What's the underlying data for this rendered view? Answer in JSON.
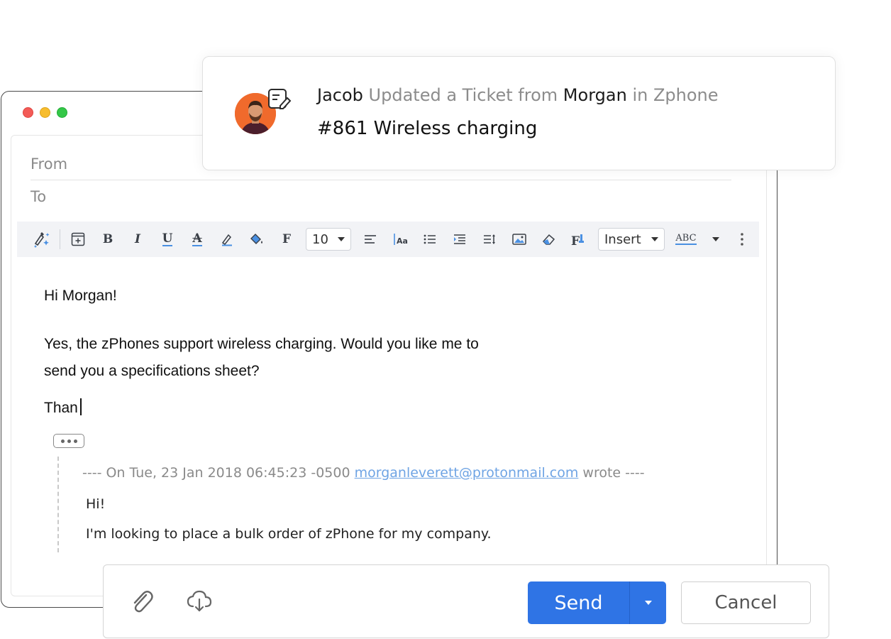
{
  "notification": {
    "actor": "Jacob",
    "action": "Updated a Ticket from",
    "customer": "Morgan",
    "in_label": "in Zphone",
    "ticket_title": "#861 Wireless charging"
  },
  "compose": {
    "from_label": "From",
    "to_label": "To",
    "toolbar": {
      "font_size": "10",
      "insert_label": "Insert",
      "spell_label": "ABC"
    },
    "body": {
      "greeting": "Hi Morgan!",
      "line1": "Yes, the zPhones support wireless charging. Would you like me to",
      "line2": "send you a specifications sheet?",
      "typing": "Than"
    },
    "quoted": {
      "prefix": "---- On Tue, 23 Jan 2018 06:45:23 -0500",
      "email": "morganleverett@protonmail.com",
      "suffix": "wrote ----",
      "line1": "Hi!",
      "line2": "I'm looking to place a bulk order of zPhone for my company."
    }
  },
  "footer": {
    "send_label": "Send",
    "cancel_label": "Cancel"
  },
  "colors": {
    "send_button": "#2f74e5",
    "link": "#6fa4e4",
    "avatar_bg": "#f06a2c"
  }
}
